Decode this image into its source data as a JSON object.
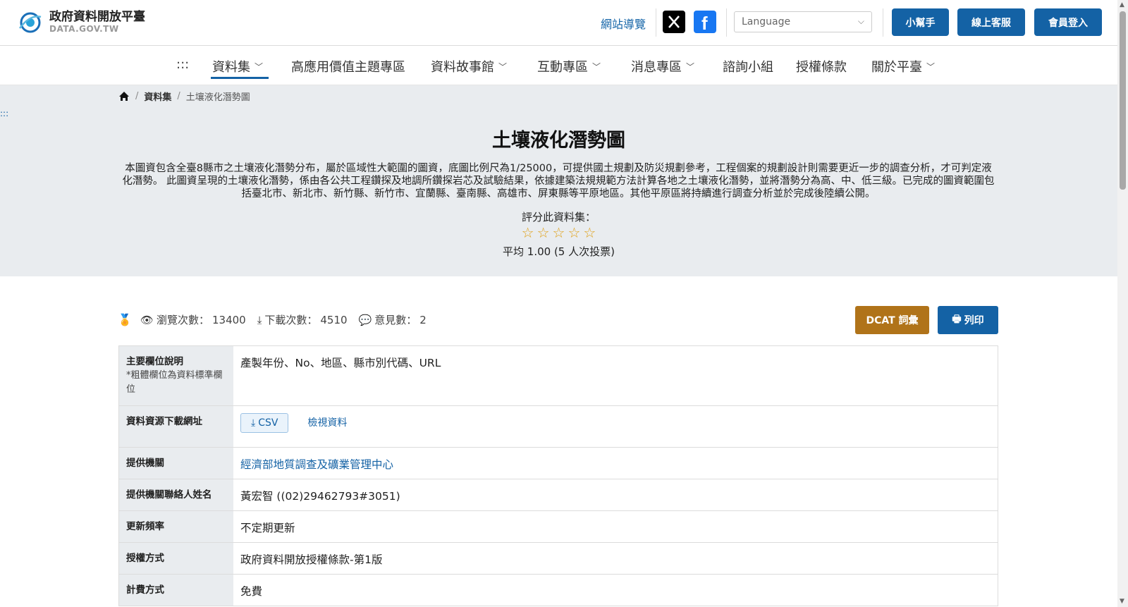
{
  "header": {
    "logo_main": "政府資料開放平臺",
    "logo_sub": "DATA.GOV.TW",
    "sitemap": "網站導覽",
    "language_placeholder": "Language",
    "buttons": {
      "helper": "小幫手",
      "service": "線上客服",
      "login": "會員登入"
    }
  },
  "nav": {
    "menu_dots": ":::",
    "items": [
      {
        "label": "資料集"
      },
      {
        "label": "高應用價值主題專區"
      },
      {
        "label": "資料故事館"
      },
      {
        "label": "互動專區"
      },
      {
        "label": "消息專區"
      },
      {
        "label": "諮詢小組"
      },
      {
        "label": "授權條款"
      },
      {
        "label": "關於平臺"
      }
    ]
  },
  "breadcrumb": {
    "level1": "資料集",
    "current": "土壤液化潛勢圖",
    "side_dots": ":::"
  },
  "dataset": {
    "title": "土壤液化潛勢圖",
    "description": "本圖資包含全臺8縣市之土壤液化潛勢分布，屬於區域性大範圍的圖資，底圖比例尺為1/25000，可提供國土規劃及防災規劃參考，工程個案的規劃設計則需要更近一步的調查分析，才可判定液化潛勢。 此圖資呈現的土壤液化潛勢，係由各公共工程鑽探及地調所鑽探岩芯及試驗結果，依據建築法規規範方法計算各地之土壤液化潛勢，並將潛勢分為高、中、低三級。已完成的圖資範圍包括臺北市、新北市、新竹縣、新竹市、宜蘭縣、臺南縣、高雄市、屏東縣等平原地區。其他平原區將持續進行調查分析並於完成後陸續公開。",
    "rating_label": "評分此資料集：",
    "rating_avg": "平均 1.00 (5 人次投票)"
  },
  "stats": {
    "views_label": "瀏覽次數：",
    "views": "13400",
    "downloads_label": "下載次數：",
    "downloads": "4510",
    "comments_label": "意見數：",
    "comments": "2"
  },
  "actions": {
    "dcat": "DCAT 詞彙",
    "print": "列印"
  },
  "table": {
    "fields_header": "主要欄位說明",
    "fields_note": "*粗體欄位為資料標準欄位",
    "fields_value": "產製年份、No、地區、縣市別代碼、URL",
    "download_header": "資料資源下載網址",
    "csv_label": "CSV",
    "view_label": "檢視資料",
    "provider_header": "提供機關",
    "provider_value": "經濟部地質調查及礦業管理中心",
    "contact_header": "提供機關聯絡人姓名",
    "contact_value": "黃宏智 ((02)29462793#3051)",
    "frequency_header": "更新頻率",
    "frequency_value": "不定期更新",
    "license_header": "授權方式",
    "license_value": "政府資料開放授權條款-第1版",
    "fee_header": "計費方式",
    "fee_value": "免費"
  },
  "colors": {
    "primary": "#1462a5",
    "dcat": "#b07319",
    "hero_bg": "#e9ecef",
    "star": "#e0a21b"
  }
}
